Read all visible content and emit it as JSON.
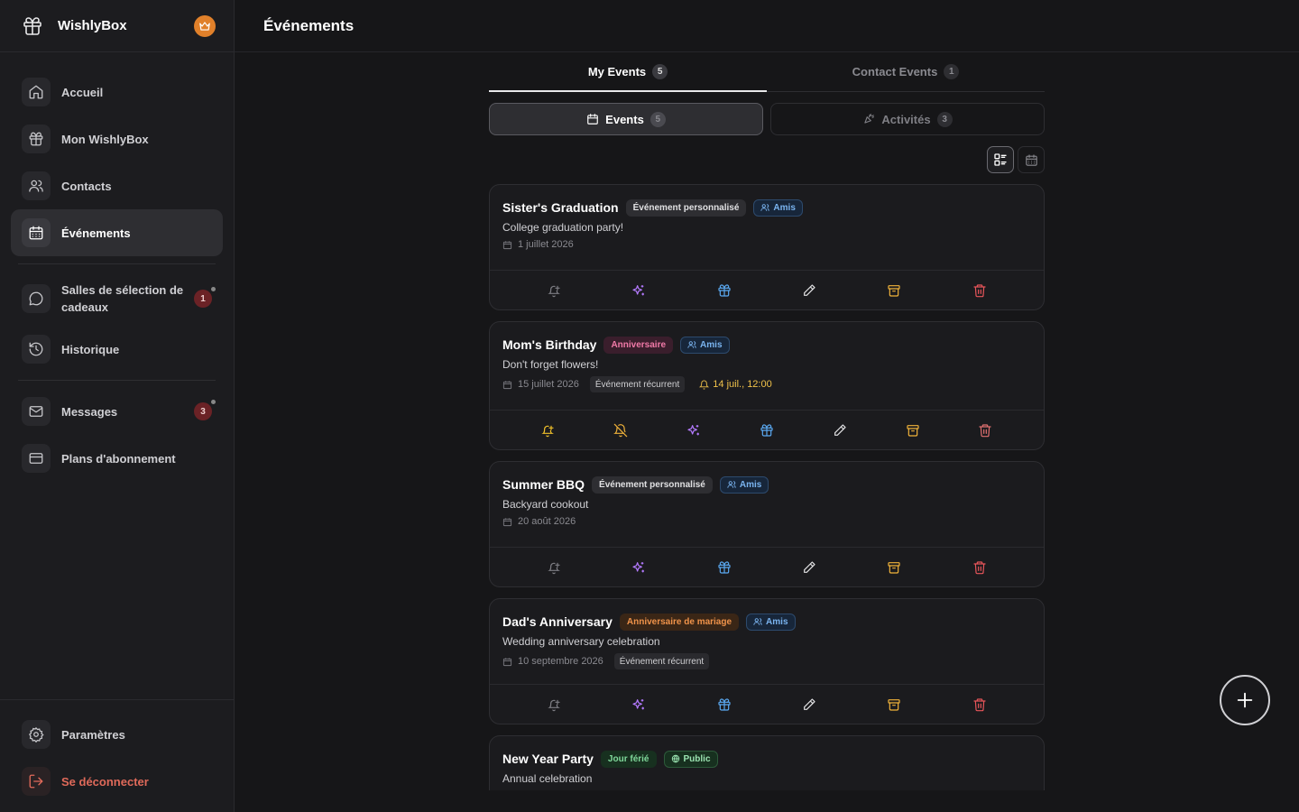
{
  "brand": {
    "name": "WishlyBox"
  },
  "sidebar": {
    "items": [
      {
        "label": "Accueil"
      },
      {
        "label": "Mon WishlyBox"
      },
      {
        "label": "Contacts"
      },
      {
        "label": "Événements"
      },
      {
        "label": "Salles de sélection de cadeaux",
        "badge": "1"
      },
      {
        "label": "Historique"
      },
      {
        "label": "Messages",
        "badge": "3"
      },
      {
        "label": "Plans d'abonnement"
      }
    ],
    "bottom": {
      "settings": "Paramètres",
      "logout": "Se déconnecter"
    }
  },
  "header": {
    "title": "Événements"
  },
  "tabs": [
    {
      "label": "My Events",
      "count": "5"
    },
    {
      "label": "Contact Events",
      "count": "1"
    }
  ],
  "segments": [
    {
      "label": "Events",
      "count": "5"
    },
    {
      "label": "Activités",
      "count": "3"
    }
  ],
  "events": [
    {
      "title": "Sister's Graduation",
      "type": "Événement personnalisé",
      "audience": "Amis",
      "description": "College graduation party!",
      "date": "1 juillet 2026"
    },
    {
      "title": "Mom's Birthday",
      "type": "Anniversaire",
      "audience": "Amis",
      "description": "Don't forget flowers!",
      "date": "15 juillet 2026",
      "recurring": "Événement récurrent",
      "reminder": "14 juil., 12:00"
    },
    {
      "title": "Summer BBQ",
      "type": "Événement personnalisé",
      "audience": "Amis",
      "description": "Backyard cookout",
      "date": "20 août 2026"
    },
    {
      "title": "Dad's Anniversary",
      "type": "Anniversaire de mariage",
      "audience": "Amis",
      "description": "Wedding anniversary celebration",
      "date": "10 septembre 2026",
      "recurring": "Événement récurrent"
    },
    {
      "title": "New Year Party",
      "type": "Jour férié",
      "audience": "Public",
      "description": "Annual celebration"
    }
  ],
  "colors": {
    "accent_crown": "#e0802a",
    "badge": "#6b2226",
    "logout": "#e06a5a"
  }
}
